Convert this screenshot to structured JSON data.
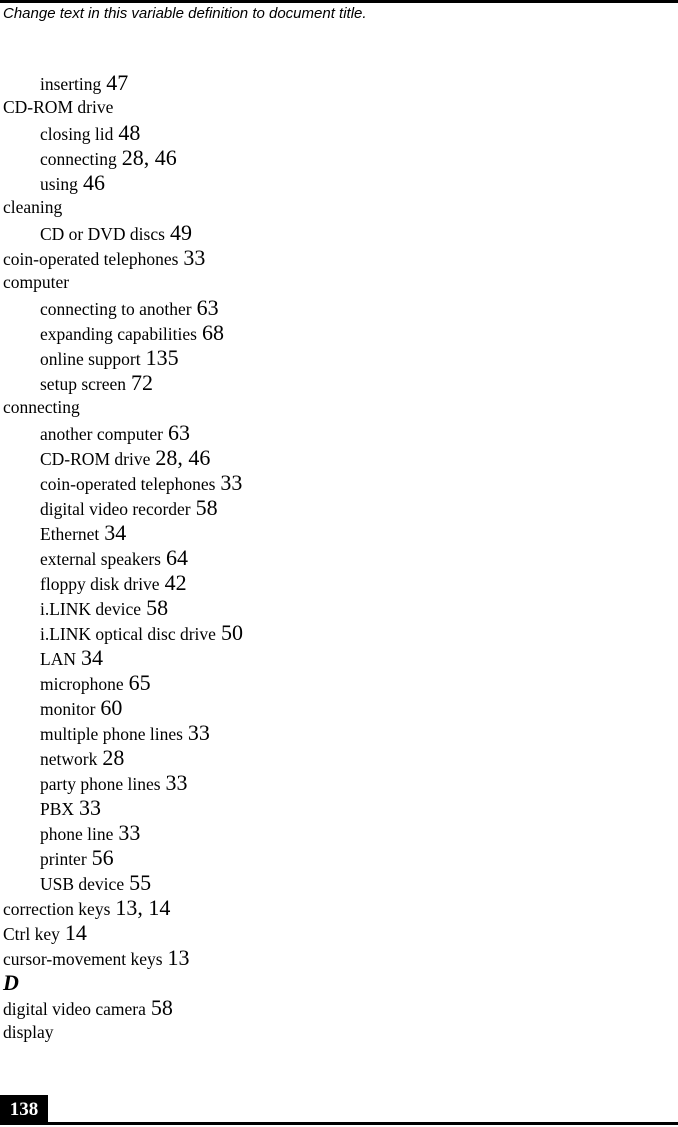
{
  "header": {
    "running_title": "Change text in this variable definition to document title."
  },
  "index": {
    "entries": [
      {
        "level": 2,
        "term": "inserting",
        "pages": "47"
      },
      {
        "level": 1,
        "term": "CD-ROM drive",
        "pages": ""
      },
      {
        "level": 2,
        "term": "closing lid",
        "pages": "48"
      },
      {
        "level": 2,
        "term": "connecting",
        "pages": "28, 46"
      },
      {
        "level": 2,
        "term": "using",
        "pages": "46"
      },
      {
        "level": 1,
        "term": "cleaning",
        "pages": ""
      },
      {
        "level": 2,
        "term": "CD or DVD discs",
        "pages": "49"
      },
      {
        "level": 1,
        "term": "coin-operated telephones",
        "pages": "33"
      },
      {
        "level": 1,
        "term": "computer",
        "pages": ""
      },
      {
        "level": 2,
        "term": "connecting to another",
        "pages": "63"
      },
      {
        "level": 2,
        "term": "expanding capabilities",
        "pages": "68"
      },
      {
        "level": 2,
        "term": "online support",
        "pages": "135"
      },
      {
        "level": 2,
        "term": "setup screen",
        "pages": "72"
      },
      {
        "level": 1,
        "term": "connecting",
        "pages": ""
      },
      {
        "level": 2,
        "term": "another computer",
        "pages": "63"
      },
      {
        "level": 2,
        "term": "CD-ROM drive",
        "pages": "28, 46"
      },
      {
        "level": 2,
        "term": "coin-operated telephones",
        "pages": "33"
      },
      {
        "level": 2,
        "term": "digital video recorder",
        "pages": "58"
      },
      {
        "level": 2,
        "term": "Ethernet",
        "pages": "34"
      },
      {
        "level": 2,
        "term": "external speakers",
        "pages": "64"
      },
      {
        "level": 2,
        "term": "floppy disk drive",
        "pages": "42"
      },
      {
        "level": 2,
        "term": "i.LINK device",
        "pages": "58"
      },
      {
        "level": 2,
        "term": "i.LINK optical disc drive",
        "pages": "50"
      },
      {
        "level": 2,
        "term": "LAN",
        "pages": "34"
      },
      {
        "level": 2,
        "term": "microphone",
        "pages": "65"
      },
      {
        "level": 2,
        "term": "monitor",
        "pages": "60"
      },
      {
        "level": 2,
        "term": "multiple phone lines",
        "pages": "33"
      },
      {
        "level": 2,
        "term": "network",
        "pages": "28"
      },
      {
        "level": 2,
        "term": "party phone lines",
        "pages": "33"
      },
      {
        "level": 2,
        "term": "PBX",
        "pages": "33"
      },
      {
        "level": 2,
        "term": "phone line",
        "pages": "33"
      },
      {
        "level": 2,
        "term": "printer",
        "pages": "56"
      },
      {
        "level": 2,
        "term": "USB device",
        "pages": "55"
      },
      {
        "level": 1,
        "term": "correction keys",
        "pages": "13, 14"
      },
      {
        "level": 1,
        "term": "Ctrl key",
        "pages": "14"
      },
      {
        "level": 1,
        "term": "cursor-movement keys",
        "pages": "13"
      },
      {
        "level": 0,
        "term": "D",
        "pages": ""
      },
      {
        "level": 1,
        "term": "digital video camera",
        "pages": "58"
      },
      {
        "level": 1,
        "term": "display",
        "pages": ""
      }
    ]
  },
  "footer": {
    "page_number": "138"
  }
}
